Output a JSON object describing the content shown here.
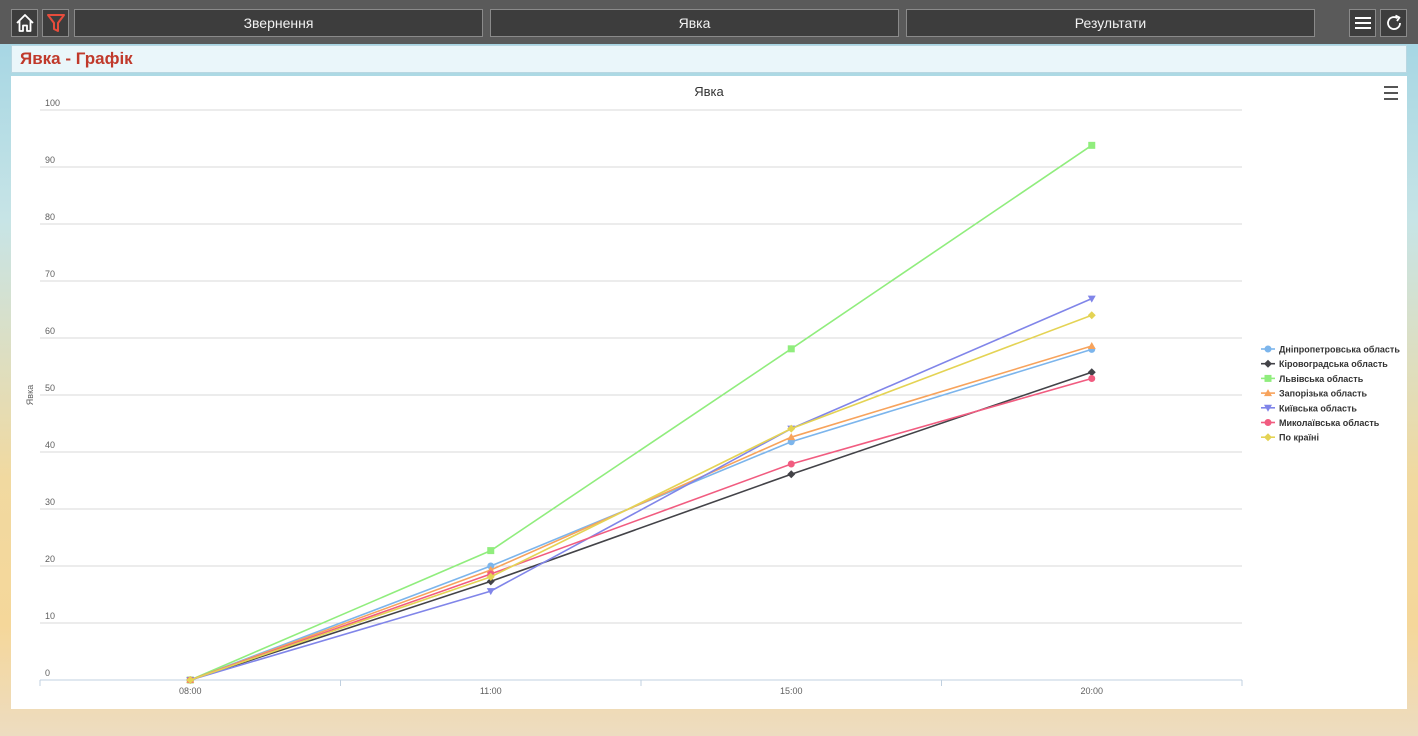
{
  "toolbar": {
    "home_icon": "home-icon",
    "filter_icon": "filter-icon",
    "menu_icon": "menu-icon",
    "refresh_icon": "refresh-icon",
    "tabs": [
      {
        "label": "Звернення"
      },
      {
        "label": "Явка"
      },
      {
        "label": "Результати"
      }
    ]
  },
  "page": {
    "title": "Явка - Графік",
    "title_color": "#c0392b"
  },
  "chart_data": {
    "type": "line",
    "title": "Явка",
    "xlabel": "",
    "ylabel": "Явка",
    "categories": [
      "08:00",
      "11:00",
      "15:00",
      "20:00"
    ],
    "ylim": [
      0,
      100
    ],
    "yticks": [
      0,
      10,
      20,
      30,
      40,
      50,
      60,
      70,
      80,
      90,
      100
    ],
    "grid": true,
    "legend_position": "right",
    "series": [
      {
        "name": "Дніпропетровська область",
        "color": "#7cb5ec",
        "marker": "circle",
        "values": [
          0,
          20,
          41.8,
          58
        ]
      },
      {
        "name": "Кіровоградська область",
        "color": "#434348",
        "marker": "diamond",
        "values": [
          0,
          17.3,
          36.1,
          54
        ]
      },
      {
        "name": "Львівська область",
        "color": "#90ed7d",
        "marker": "square",
        "values": [
          0,
          22.7,
          58.1,
          93.8
        ]
      },
      {
        "name": "Запорізька область",
        "color": "#f7a35c",
        "marker": "triangle",
        "values": [
          0,
          19.3,
          42.6,
          58.6
        ]
      },
      {
        "name": "Київська область",
        "color": "#8085e9",
        "marker": "triangle-down",
        "values": [
          0,
          15.6,
          44.1,
          66.9
        ]
      },
      {
        "name": "Миколаївська область",
        "color": "#f15c80",
        "marker": "circle",
        "values": [
          0,
          18.6,
          37.9,
          52.9
        ]
      },
      {
        "name": "По країні",
        "color": "#e4d354",
        "marker": "diamond",
        "values": [
          0,
          18.1,
          44.1,
          64
        ]
      }
    ]
  }
}
